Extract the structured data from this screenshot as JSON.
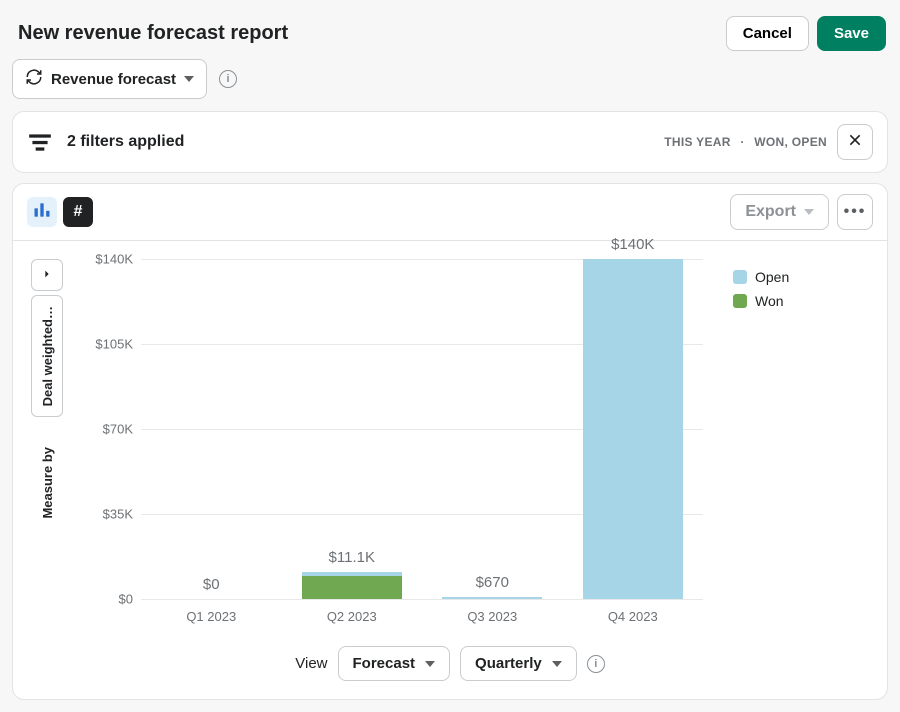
{
  "header": {
    "title": "New revenue forecast report",
    "cancel": "Cancel",
    "save": "Save"
  },
  "reportType": {
    "label": "Revenue forecast"
  },
  "filters": {
    "count_text": "2 filters applied",
    "period": "THIS YEAR",
    "separator": "·",
    "statuses": "WON, OPEN"
  },
  "toolbar": {
    "export": "Export"
  },
  "side": {
    "metric": "Deal weighted…",
    "measure_label": "Measure by"
  },
  "legend": {
    "open": "Open",
    "won": "Won"
  },
  "colors": {
    "open": "#a6d5e8",
    "won": "#6fa850"
  },
  "controls": {
    "view": "View",
    "forecast": "Forecast",
    "granularity": "Quarterly"
  },
  "chart_data": {
    "type": "bar",
    "stacked": true,
    "title": "",
    "xlabel": "",
    "ylabel": "Deal weighted value",
    "ylim": [
      0,
      140000
    ],
    "yticks": [
      0,
      35000,
      70000,
      105000,
      140000
    ],
    "ytick_labels": [
      "$0",
      "$35K",
      "$70K",
      "$105K",
      "$140K"
    ],
    "categories": [
      "Q1 2023",
      "Q2 2023",
      "Q3 2023",
      "Q4 2023"
    ],
    "series": [
      {
        "name": "Won",
        "color": "#6fa850",
        "values": [
          0,
          9500,
          0,
          0
        ]
      },
      {
        "name": "Open",
        "color": "#a6d5e8",
        "values": [
          0,
          1600,
          670,
          140000
        ]
      }
    ],
    "totals_labels": [
      "$0",
      "$11.1K",
      "$670",
      "$140K"
    ]
  }
}
